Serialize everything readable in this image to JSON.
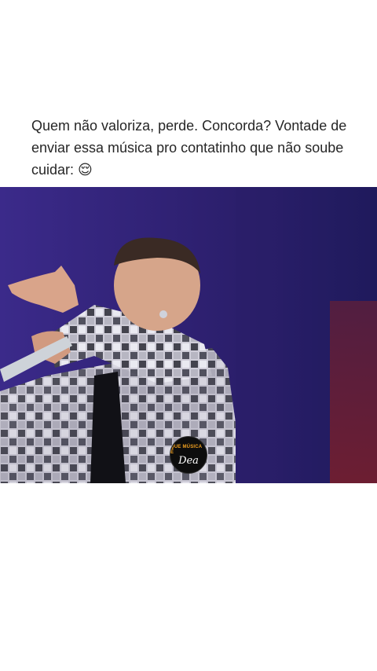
{
  "post": {
    "caption": "Quem não valoriza, perde. Concorda? Vontade de enviar essa música pro contatinho que não soube cuidar: 😌"
  },
  "video": {
    "logo_text_top": "QUE MÚSICA É",
    "logo_text_bottom": "Dea",
    "background_color": "#3a2783",
    "accent_color": "#f0a020"
  }
}
